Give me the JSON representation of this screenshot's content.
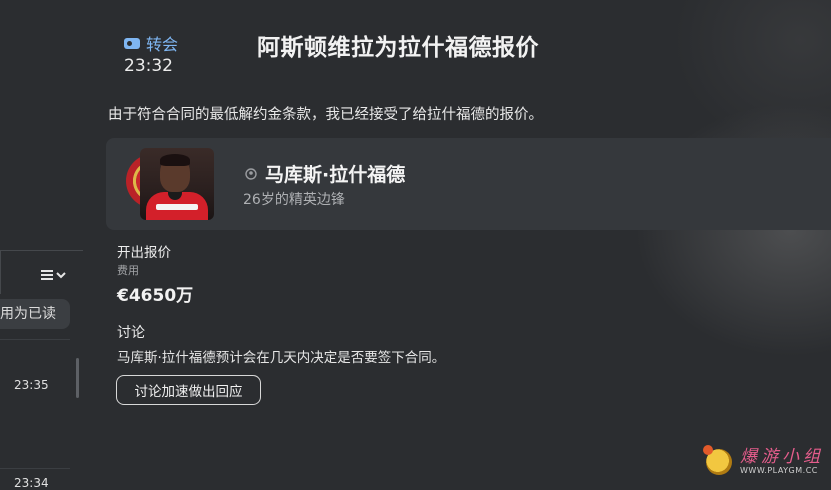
{
  "header": {
    "category": "转会",
    "time": "23:32",
    "title": "阿斯顿维拉为拉什福德报价"
  },
  "message_body": "由于符合合同的最低解约金条款，我已经接受了给拉什福德的报价。",
  "player": {
    "name": "马库斯·拉什福德",
    "description": "26岁的精英边锋"
  },
  "offer": {
    "heading": "开出报价",
    "fee_label": "费用",
    "fee_value": "€4650万"
  },
  "discussion": {
    "heading": "讨论",
    "text": "马库斯·拉什福德预计会在几天内决定是否要签下合同。",
    "button_label": "讨论加速做出回应"
  },
  "left_panel": {
    "mark_read_label": "用为已读",
    "message_times": [
      "23:35",
      "23:34"
    ]
  },
  "watermark": {
    "title": "爆游小组",
    "url": "WWW.PLAYGM.CC"
  },
  "icons": {
    "category": "tag-icon",
    "player": "person-icon",
    "sort": "list-sort-icon"
  },
  "colors": {
    "background": "#2b2d30",
    "card": "#35383c",
    "accent_blue": "#7fb6f2"
  }
}
